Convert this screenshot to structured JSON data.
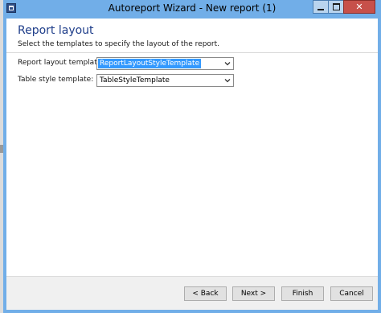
{
  "window": {
    "title": "Autoreport Wizard - New report (1)",
    "close_glyph": "✕"
  },
  "page": {
    "heading": "Report layout",
    "description": "Select the templates to specify the layout of the report."
  },
  "fields": {
    "report_layout": {
      "label": "Report layout template:",
      "value": "ReportLayoutStyleTemplate"
    },
    "table_style": {
      "label": "Table style template:",
      "value": "TableStyleTemplate"
    }
  },
  "buttons": {
    "back": "< Back",
    "next": "Next >",
    "finish": "Finish",
    "cancel": "Cancel"
  },
  "colors": {
    "title_bar": "#71aee8",
    "heading": "#1f3e8a",
    "selection": "#3399ff",
    "close_button": "#c7504a"
  }
}
